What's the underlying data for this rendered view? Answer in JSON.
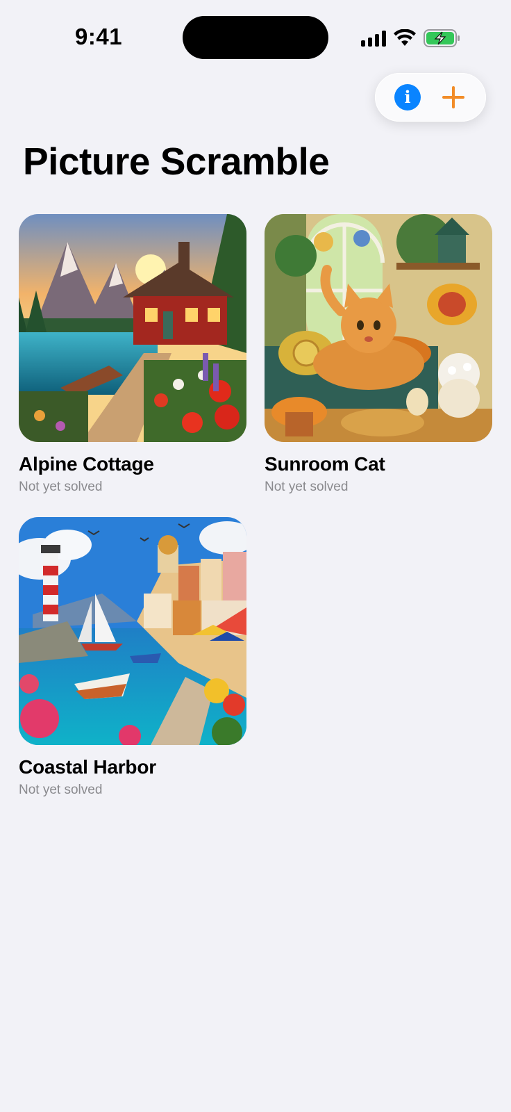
{
  "status_bar": {
    "time": "9:41"
  },
  "toolbar": {
    "info_icon": "info-icon",
    "add_icon": "plus-icon",
    "accent": "#0a84ff",
    "add_color": "#f28c28"
  },
  "page": {
    "title": "Picture Scramble"
  },
  "puzzles": [
    {
      "title": "Alpine Cottage",
      "status": "Not yet solved"
    },
    {
      "title": "Sunroom Cat",
      "status": "Not yet solved"
    },
    {
      "title": "Coastal Harbor",
      "status": "Not yet solved"
    }
  ]
}
